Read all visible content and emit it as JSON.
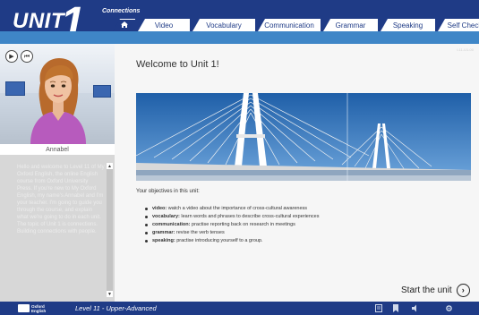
{
  "header": {
    "unit_word": "UNIT",
    "unit_number": "1",
    "subtitle": "Connections",
    "tabs": [
      {
        "label": "",
        "icon": "home-icon",
        "active": true
      },
      {
        "label": "Video"
      },
      {
        "label": "Vocabulary"
      },
      {
        "label": "Communication"
      },
      {
        "label": "Grammar"
      },
      {
        "label": "Speaking"
      },
      {
        "label": "Self Check"
      }
    ]
  },
  "sidebar": {
    "avatar_name": "Annabel",
    "media_buttons": [
      "play-icon",
      "rewind-icon"
    ],
    "transcript": "Hello and welcome to Level 11 of My Oxford English, the online English course from Oxford University Press. If you're new to My Oxford English, my name's Annabel and I'm your teacher. I'm going to guide you through the course, and explain what we're going to do in each unit. The topic of Unit 1 is connections. Building connections with people."
  },
  "main": {
    "title": "Welcome to Unit 1!",
    "page_id": "L11-U1-00",
    "objectives_intro": "Your objectives in this unit:",
    "objectives": [
      {
        "key": "video:",
        "text": " watch a video about the importance of cross-cultural awareness"
      },
      {
        "key": "vocabulary:",
        "text": " learn words and phrases to describe cross-cultural experiences"
      },
      {
        "key": "communication:",
        "text": " practise reporting back on research in meetings"
      },
      {
        "key": "grammar:",
        "text": " revise the verb tenses"
      },
      {
        "key": "speaking:",
        "text": " practise introducing yourself to a group."
      }
    ],
    "start_label": "Start the unit"
  },
  "footer": {
    "logo_line1": "Oxford",
    "logo_line2": "English",
    "level": "Level 11 - Upper-Advanced",
    "icons": [
      "notebook-icon",
      "bookmark-icon",
      "volume-icon",
      "settings-icon"
    ]
  },
  "colors": {
    "brand_navy": "#1f3b86",
    "brand_blue": "#3f86c7",
    "sidebar_gray": "#d7d7d7",
    "content_bg": "#f6f6f6"
  }
}
